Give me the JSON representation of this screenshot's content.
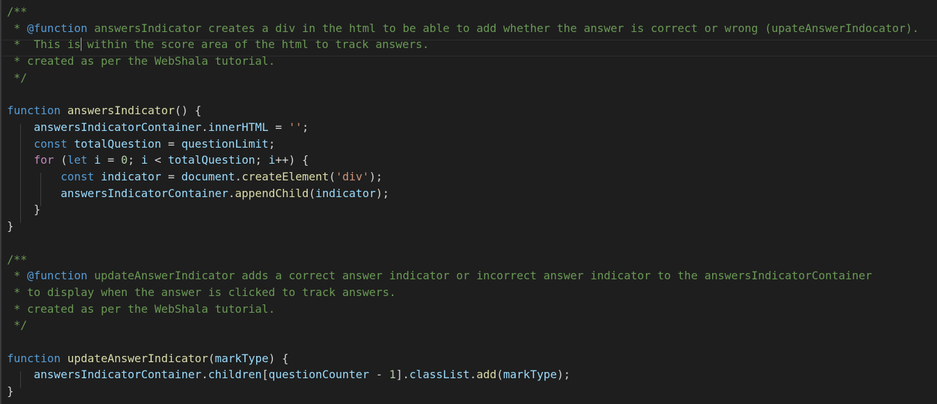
{
  "editor": {
    "lines": [
      [
        {
          "t": "/**",
          "k": "comment"
        }
      ],
      [
        {
          "t": " * ",
          "k": "comment"
        },
        {
          "t": "@function",
          "k": "doctag"
        },
        {
          "t": " answersIndicator creates a div in the html to be able to add whether the answer is correct or wrong (upateAnswerIndocator).",
          "k": "comment"
        }
      ],
      [
        {
          "t": " *  This is",
          "k": "comment"
        },
        {
          "cursor": true
        },
        {
          "t": " within the score area of the html to track answers.",
          "k": "comment"
        }
      ],
      [
        {
          "t": " * created as per the WebShala tutorial.",
          "k": "comment"
        }
      ],
      [
        {
          "t": " */",
          "k": "comment"
        }
      ],
      [],
      [
        {
          "t": "function",
          "k": "keyword"
        },
        {
          "t": " ",
          "k": "punct"
        },
        {
          "t": "answersIndicator",
          "k": "function"
        },
        {
          "t": "() {",
          "k": "punct"
        }
      ],
      [
        {
          "t": "    ",
          "k": "punct"
        },
        {
          "t": "answersIndicatorContainer",
          "k": "variable"
        },
        {
          "t": ".",
          "k": "punct"
        },
        {
          "t": "innerHTML",
          "k": "variable"
        },
        {
          "t": " = ",
          "k": "punct"
        },
        {
          "t": "''",
          "k": "string"
        },
        {
          "t": ";",
          "k": "punct"
        }
      ],
      [
        {
          "t": "    ",
          "k": "punct"
        },
        {
          "t": "const",
          "k": "keyword"
        },
        {
          "t": " ",
          "k": "punct"
        },
        {
          "t": "totalQuestion",
          "k": "variable"
        },
        {
          "t": " = ",
          "k": "punct"
        },
        {
          "t": "questionLimit",
          "k": "variable"
        },
        {
          "t": ";",
          "k": "punct"
        }
      ],
      [
        {
          "t": "    ",
          "k": "punct"
        },
        {
          "t": "for",
          "k": "control"
        },
        {
          "t": " (",
          "k": "punct"
        },
        {
          "t": "let",
          "k": "keyword"
        },
        {
          "t": " ",
          "k": "punct"
        },
        {
          "t": "i",
          "k": "variable"
        },
        {
          "t": " = ",
          "k": "punct"
        },
        {
          "t": "0",
          "k": "number"
        },
        {
          "t": "; ",
          "k": "punct"
        },
        {
          "t": "i",
          "k": "variable"
        },
        {
          "t": " < ",
          "k": "punct"
        },
        {
          "t": "totalQuestion",
          "k": "variable"
        },
        {
          "t": "; ",
          "k": "punct"
        },
        {
          "t": "i",
          "k": "variable"
        },
        {
          "t": "++) {",
          "k": "punct"
        }
      ],
      [
        {
          "t": "        ",
          "k": "punct"
        },
        {
          "t": "const",
          "k": "keyword"
        },
        {
          "t": " ",
          "k": "punct"
        },
        {
          "t": "indicator",
          "k": "variable"
        },
        {
          "t": " = ",
          "k": "punct"
        },
        {
          "t": "document",
          "k": "variable"
        },
        {
          "t": ".",
          "k": "punct"
        },
        {
          "t": "createElement",
          "k": "function"
        },
        {
          "t": "(",
          "k": "punct"
        },
        {
          "t": "'div'",
          "k": "string"
        },
        {
          "t": ");",
          "k": "punct"
        }
      ],
      [
        {
          "t": "        ",
          "k": "punct"
        },
        {
          "t": "answersIndicatorContainer",
          "k": "variable"
        },
        {
          "t": ".",
          "k": "punct"
        },
        {
          "t": "appendChild",
          "k": "function"
        },
        {
          "t": "(",
          "k": "punct"
        },
        {
          "t": "indicator",
          "k": "variable"
        },
        {
          "t": ");",
          "k": "punct"
        }
      ],
      [
        {
          "t": "    }",
          "k": "punct"
        }
      ],
      [
        {
          "t": "}",
          "k": "punct"
        }
      ],
      [],
      [
        {
          "t": "/**",
          "k": "comment"
        }
      ],
      [
        {
          "t": " * ",
          "k": "comment"
        },
        {
          "t": "@function",
          "k": "doctag"
        },
        {
          "t": " updateAnswerIndicator adds a correct answer indicator or incorrect answer indicator to the answersIndicatorContainer",
          "k": "comment"
        }
      ],
      [
        {
          "t": " * to display when the answer is clicked to track answers.",
          "k": "comment"
        }
      ],
      [
        {
          "t": " * created as per the WebShala tutorial.",
          "k": "comment"
        }
      ],
      [
        {
          "t": " */",
          "k": "comment"
        }
      ],
      [],
      [
        {
          "t": "function",
          "k": "keyword"
        },
        {
          "t": " ",
          "k": "punct"
        },
        {
          "t": "updateAnswerIndicator",
          "k": "function"
        },
        {
          "t": "(",
          "k": "punct"
        },
        {
          "t": "markType",
          "k": "variable"
        },
        {
          "t": ") {",
          "k": "punct"
        }
      ],
      [
        {
          "t": "    ",
          "k": "punct"
        },
        {
          "t": "answersIndicatorContainer",
          "k": "variable"
        },
        {
          "t": ".",
          "k": "punct"
        },
        {
          "t": "children",
          "k": "variable"
        },
        {
          "t": "[",
          "k": "punct"
        },
        {
          "t": "questionCounter",
          "k": "variable"
        },
        {
          "t": " - ",
          "k": "punct"
        },
        {
          "t": "1",
          "k": "number"
        },
        {
          "t": "].",
          "k": "punct"
        },
        {
          "t": "classList",
          "k": "variable"
        },
        {
          "t": ".",
          "k": "punct"
        },
        {
          "t": "add",
          "k": "function"
        },
        {
          "t": "(",
          "k": "punct"
        },
        {
          "t": "markType",
          "k": "variable"
        },
        {
          "t": ");",
          "k": "punct"
        }
      ],
      [
        {
          "t": "}",
          "k": "punct"
        }
      ]
    ]
  }
}
